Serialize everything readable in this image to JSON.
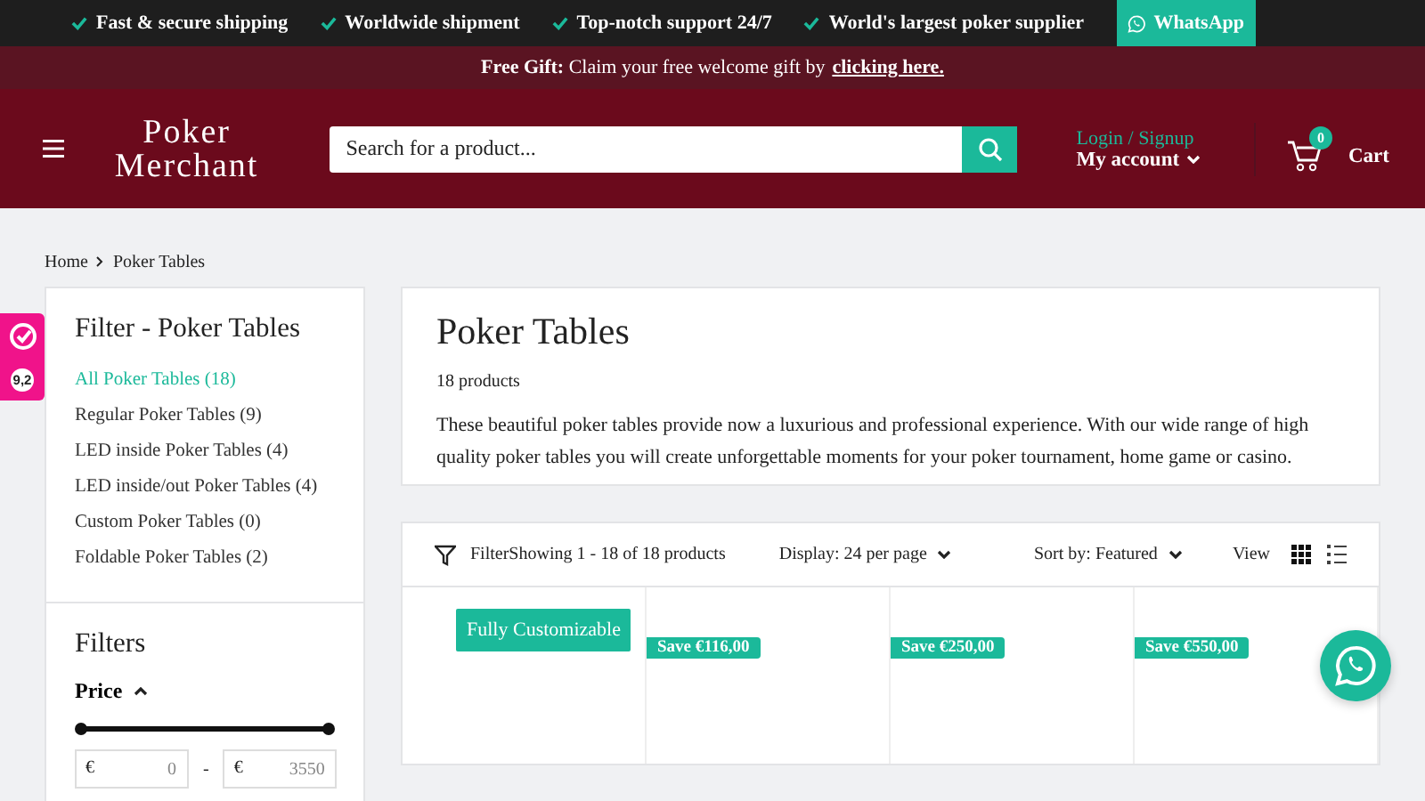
{
  "top_bar": {
    "features": [
      "Fast & secure shipping",
      "Worldwide shipment",
      "Top-notch support 24/7",
      "World's largest poker supplier"
    ],
    "whatsapp": "WhatsApp"
  },
  "promo": {
    "text": "**Free Gift:** Claim your free welcome gift by",
    "link": "clicking here."
  },
  "header": {
    "logo_top": "Poker",
    "logo_bottom": "Merchant",
    "search": {
      "placeholder": "Search for a product..."
    },
    "login": "Login / Signup",
    "account": "My account",
    "cart_count": "0",
    "cart": "Cart"
  },
  "review_badge": {
    "score": "9,2"
  },
  "breadcrumb": [
    "Home",
    "Poker Tables"
  ],
  "sidebar": {
    "title": "Filter - Poker Tables",
    "items": [
      {
        "label": "All Poker Tables (18)",
        "selected": true
      },
      {
        "label": "Regular Poker Tables (9)",
        "selected": false
      },
      {
        "label": "LED inside Poker Tables (4)",
        "selected": false
      },
      {
        "label": "LED inside/out Poker Tables (4)",
        "selected": false
      },
      {
        "label": "Custom Poker Tables (0)",
        "selected": false
      },
      {
        "label": "Foldable Poker Tables (2)",
        "selected": false
      }
    ],
    "filters_title": "Filters",
    "price": {
      "label": "Price",
      "expanded": true,
      "level": 1,
      "currency_min": "€",
      "min": "0",
      "currency_max": "€",
      "max": "3550",
      "separator": "-"
    }
  },
  "collection": {
    "title": "Poker Tables",
    "count": "18 products",
    "description": "These beautiful poker tables provide now a luxurious and professional experience. With our wide range of high quality poker tables you will create unforgettable moments for your poker tournament, home game or casino."
  },
  "toolbar": {
    "filter": "Filter",
    "showing": "Showing 1 - 18 of 18 products",
    "display": "Display: 24 per page",
    "sort": "Sort by: Featured",
    "view": "View",
    "grid_selected": true
  },
  "products": [
    {
      "kind": "label",
      "badge": "Fully Customizable"
    },
    {
      "kind": "save",
      "badge": "Save €116,00"
    },
    {
      "kind": "save",
      "badge": "Save €250,00"
    },
    {
      "kind": "save",
      "badge": "Save €550,00"
    }
  ]
}
